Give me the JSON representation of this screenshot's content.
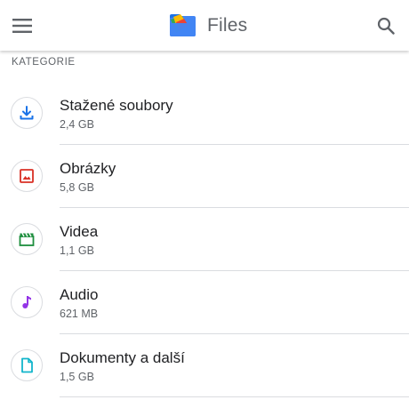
{
  "app_bar": {
    "title": "Files",
    "menu_icon": "hamburger-menu-icon",
    "search_icon": "search-icon",
    "logo_icon": "files-logo-icon"
  },
  "section": {
    "header": "KATEGORIE"
  },
  "categories": [
    {
      "label": "Stažené soubory",
      "size": "2,4 GB",
      "icon": "download-icon",
      "color": "#1a73e8"
    },
    {
      "label": "Obrázky",
      "size": "5,8 GB",
      "icon": "image-icon",
      "color": "#d93025"
    },
    {
      "label": "Videa",
      "size": "1,1 GB",
      "icon": "video-clapper-icon",
      "color": "#1e8e3e"
    },
    {
      "label": "Audio",
      "size": "621 MB",
      "icon": "music-note-icon",
      "color": "#9334e6"
    },
    {
      "label": "Dokumenty a další",
      "size": "1,5 GB",
      "icon": "document-icon",
      "color": "#12b5cb"
    }
  ]
}
